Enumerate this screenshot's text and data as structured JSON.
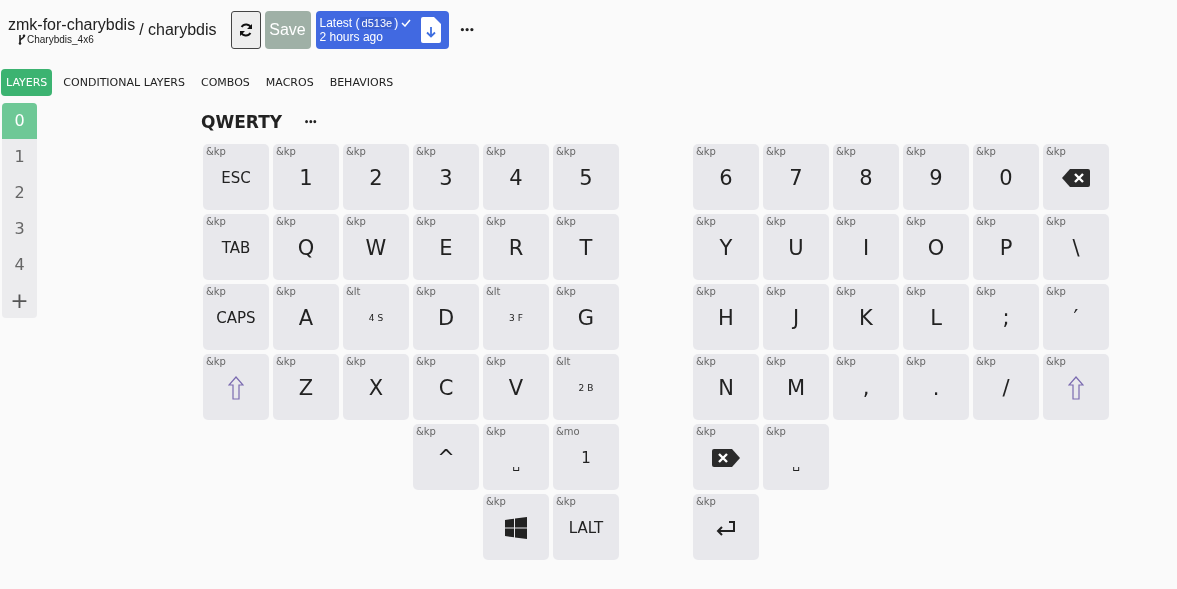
{
  "header": {
    "repo": "zmk-for-charybdis",
    "branch": "Charybdis_4x6",
    "keyboard": "/ charybdis",
    "save": {
      "label": "Save",
      "disabled": true
    },
    "version": {
      "label": "Latest (",
      "commit": "d513e",
      "close": ")",
      "time": "2 hours ago"
    },
    "more": "•••"
  },
  "tabs": [
    {
      "label": "LAYERS",
      "selected": true
    },
    {
      "label": "CONDITIONAL LAYERS",
      "selected": false
    },
    {
      "label": "COMBOS",
      "selected": false
    },
    {
      "label": "MACROS",
      "selected": false
    },
    {
      "label": "BEHAVIORS",
      "selected": false
    }
  ],
  "layers": [
    {
      "label": "0",
      "selected": true
    },
    {
      "label": "1",
      "selected": false
    },
    {
      "label": "2",
      "selected": false
    },
    {
      "label": "3",
      "selected": false
    },
    {
      "label": "4",
      "selected": false
    }
  ],
  "add_layer": "+",
  "layer_title": "QWERTY",
  "layer_menu": "•••",
  "left_half": [
    [
      {
        "binding": "&kp",
        "kind": "word",
        "label": "ESC"
      },
      {
        "binding": "&kp",
        "kind": "char",
        "label": "1"
      },
      {
        "binding": "&kp",
        "kind": "char",
        "label": "2"
      },
      {
        "binding": "&kp",
        "kind": "char",
        "label": "3"
      },
      {
        "binding": "&kp",
        "kind": "char",
        "label": "4"
      },
      {
        "binding": "&kp",
        "kind": "char",
        "label": "5"
      }
    ],
    [
      {
        "binding": "&kp",
        "kind": "word",
        "label": "TAB"
      },
      {
        "binding": "&kp",
        "kind": "char",
        "label": "Q"
      },
      {
        "binding": "&kp",
        "kind": "char",
        "label": "W"
      },
      {
        "binding": "&kp",
        "kind": "char",
        "label": "E"
      },
      {
        "binding": "&kp",
        "kind": "char",
        "label": "R"
      },
      {
        "binding": "&kp",
        "kind": "char",
        "label": "T"
      }
    ],
    [
      {
        "binding": "&kp",
        "kind": "word",
        "label": "CAPS"
      },
      {
        "binding": "&kp",
        "kind": "char",
        "label": "A"
      },
      {
        "binding": "&lt",
        "kind": "layer",
        "label": "4 S"
      },
      {
        "binding": "&kp",
        "kind": "char",
        "label": "D"
      },
      {
        "binding": "&lt",
        "kind": "layer",
        "label": "3 F"
      },
      {
        "binding": "&kp",
        "kind": "char",
        "label": "G"
      }
    ],
    [
      {
        "binding": "&kp",
        "kind": "shift"
      },
      {
        "binding": "&kp",
        "kind": "char",
        "label": "Z"
      },
      {
        "binding": "&kp",
        "kind": "char",
        "label": "X"
      },
      {
        "binding": "&kp",
        "kind": "char",
        "label": "C"
      },
      {
        "binding": "&kp",
        "kind": "char",
        "label": "V"
      },
      {
        "binding": "&lt",
        "kind": "layer",
        "label": "2 B"
      }
    ],
    [
      {
        "binding": "&kp",
        "kind": "char",
        "label": "^"
      },
      {
        "binding": "&kp",
        "kind": "space",
        "label": "␣"
      },
      {
        "binding": "&mo",
        "kind": "word",
        "label": "1"
      }
    ],
    [
      {
        "binding": "&kp",
        "kind": "windows"
      },
      {
        "binding": "&kp",
        "kind": "word",
        "label": "LALT"
      }
    ]
  ],
  "right_half": [
    [
      {
        "binding": "&kp",
        "kind": "char",
        "label": "6"
      },
      {
        "binding": "&kp",
        "kind": "char",
        "label": "7"
      },
      {
        "binding": "&kp",
        "kind": "char",
        "label": "8"
      },
      {
        "binding": "&kp",
        "kind": "char",
        "label": "9"
      },
      {
        "binding": "&kp",
        "kind": "char",
        "label": "0"
      },
      {
        "binding": "&kp",
        "kind": "backspace"
      }
    ],
    [
      {
        "binding": "&kp",
        "kind": "char",
        "label": "Y"
      },
      {
        "binding": "&kp",
        "kind": "char",
        "label": "U"
      },
      {
        "binding": "&kp",
        "kind": "char",
        "label": "I"
      },
      {
        "binding": "&kp",
        "kind": "char",
        "label": "O"
      },
      {
        "binding": "&kp",
        "kind": "char",
        "label": "P"
      },
      {
        "binding": "&kp",
        "kind": "char",
        "label": "\\"
      }
    ],
    [
      {
        "binding": "&kp",
        "kind": "char",
        "label": "H"
      },
      {
        "binding": "&kp",
        "kind": "char",
        "label": "J"
      },
      {
        "binding": "&kp",
        "kind": "char",
        "label": "K"
      },
      {
        "binding": "&kp",
        "kind": "char",
        "label": "L"
      },
      {
        "binding": "&kp",
        "kind": "char",
        "label": ";"
      },
      {
        "binding": "&kp",
        "kind": "char",
        "label": "′"
      }
    ],
    [
      {
        "binding": "&kp",
        "kind": "char",
        "label": "N"
      },
      {
        "binding": "&kp",
        "kind": "char",
        "label": "M"
      },
      {
        "binding": "&kp",
        "kind": "char",
        "label": ","
      },
      {
        "binding": "&kp",
        "kind": "char",
        "label": "."
      },
      {
        "binding": "&kp",
        "kind": "char",
        "label": "/"
      },
      {
        "binding": "&kp",
        "kind": "shift"
      }
    ],
    [
      {
        "binding": "&kp",
        "kind": "delete"
      },
      {
        "binding": "&kp",
        "kind": "space",
        "label": "␣"
      }
    ],
    [
      {
        "binding": "&kp",
        "kind": "enter"
      }
    ]
  ]
}
